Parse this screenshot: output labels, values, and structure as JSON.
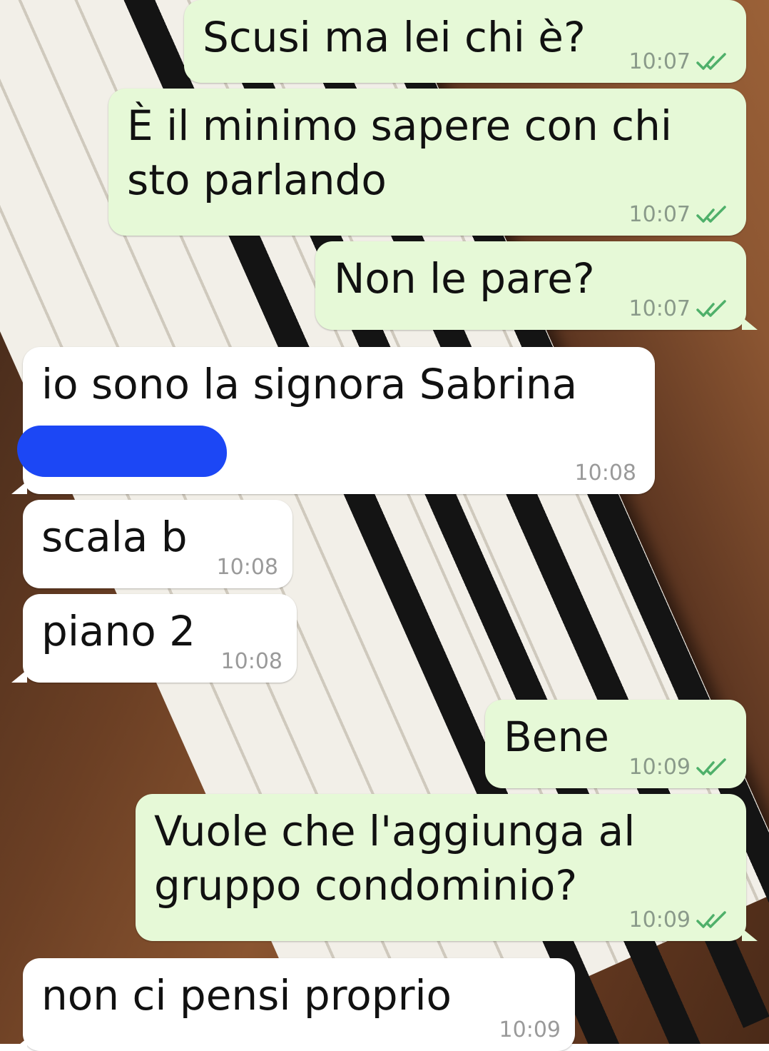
{
  "colors": {
    "outgoing_bubble": "#e6f9d7",
    "incoming_bubble": "#ffffff",
    "read_ticks": "#4fb06a",
    "redaction": "#1c47f5"
  },
  "icons": {
    "read_receipt": "double-check-icon"
  },
  "messages": [
    {
      "dir": "out",
      "text": "Scusi ma lei chi è?",
      "time": "10:07",
      "read": true
    },
    {
      "dir": "out",
      "text": "È il minimo sapere con chi sto parlando",
      "time": "10:07",
      "read": true
    },
    {
      "dir": "out",
      "text": "Non le pare?",
      "time": "10:07",
      "read": true
    },
    {
      "dir": "in",
      "text": "io sono la signora Sabrina",
      "time": "10:08",
      "redacted": true
    },
    {
      "dir": "in",
      "text": "scala b",
      "time": "10:08"
    },
    {
      "dir": "in",
      "text": "piano 2",
      "time": "10:08"
    },
    {
      "dir": "out",
      "text": "Bene",
      "time": "10:09",
      "read": true
    },
    {
      "dir": "out",
      "text": "Vuole che l'aggiunga al gruppo condominio?",
      "time": "10:09",
      "read": true
    },
    {
      "dir": "in",
      "text": "non ci pensi proprio",
      "time": "10:09"
    }
  ]
}
